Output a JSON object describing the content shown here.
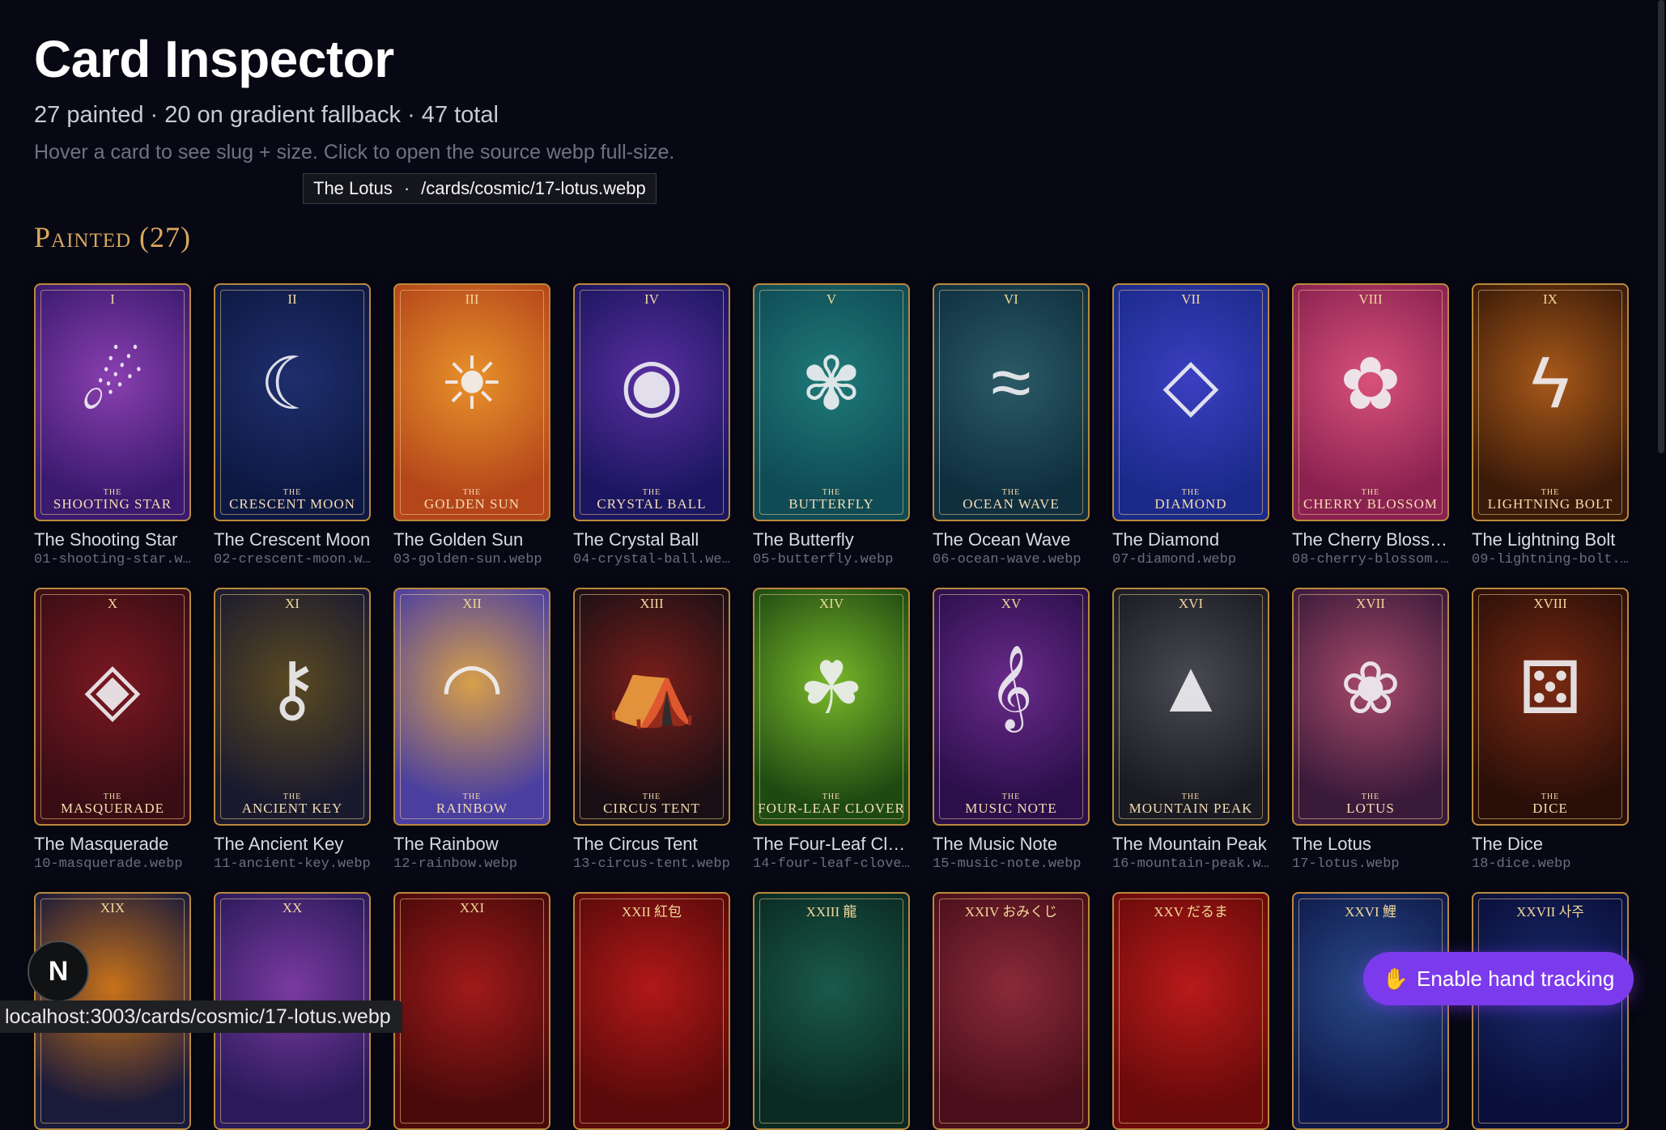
{
  "header": {
    "title": "Card Inspector",
    "stats": "27 painted · 20 on gradient fallback · 47 total",
    "hint": "Hover a card to see slug + size. Click to open the source webp full-size."
  },
  "tooltip": {
    "name": "The Lotus",
    "separator": "·",
    "path": "/cards/cosmic/17-lotus.webp"
  },
  "section": {
    "title": "Painted (27)"
  },
  "cards": [
    {
      "numeral": "I",
      "caption": "Shooting Star",
      "name": "The Shooting Star",
      "slug": "01-shooting-star.webp",
      "colors": [
        "#3a1a6e",
        "#8a3fb0"
      ],
      "glyph": "☄",
      "icon": "comet-icon"
    },
    {
      "numeral": "II",
      "caption": "Crescent Moon",
      "name": "The Crescent Moon",
      "slug": "02-crescent-moon.webp",
      "colors": [
        "#0d1842",
        "#1f2f6e"
      ],
      "glyph": "☾",
      "icon": "moon-icon"
    },
    {
      "numeral": "III",
      "caption": "Golden Sun",
      "name": "The Golden Sun",
      "slug": "03-golden-sun.webp",
      "colors": [
        "#b4461a",
        "#e8922b"
      ],
      "glyph": "☀",
      "icon": "sun-icon"
    },
    {
      "numeral": "IV",
      "caption": "Crystal Ball",
      "name": "The Crystal Ball",
      "slug": "04-crystal-ball.webp",
      "colors": [
        "#1b1660",
        "#5a2fa0"
      ],
      "glyph": "◉",
      "icon": "crystal-ball-icon"
    },
    {
      "numeral": "V",
      "caption": "Butterfly",
      "name": "The Butterfly",
      "slug": "05-butterfly.webp",
      "colors": [
        "#0f4b55",
        "#1f7a78"
      ],
      "glyph": "✾",
      "icon": "butterfly-icon"
    },
    {
      "numeral": "VI",
      "caption": "Ocean Wave",
      "name": "The Ocean Wave",
      "slug": "06-ocean-wave.webp",
      "colors": [
        "#0f2f3f",
        "#2b5a66"
      ],
      "glyph": "≈",
      "icon": "wave-icon"
    },
    {
      "numeral": "VII",
      "caption": "Diamond",
      "name": "The Diamond",
      "slug": "07-diamond.webp",
      "colors": [
        "#1b2a8a",
        "#3b3fc0"
      ],
      "glyph": "◇",
      "icon": "diamond-icon"
    },
    {
      "numeral": "VIII",
      "caption": "Cherry Blossom",
      "name": "The Cherry Blossom",
      "slug": "08-cherry-blossom.webp",
      "colors": [
        "#8a2150",
        "#d8527a"
      ],
      "glyph": "✿",
      "icon": "blossom-icon"
    },
    {
      "numeral": "IX",
      "caption": "Lightning Bolt",
      "name": "The Lightning Bolt",
      "slug": "09-lightning-bolt.webp",
      "colors": [
        "#3a1a08",
        "#a8591a"
      ],
      "glyph": "ϟ",
      "icon": "lightning-icon"
    },
    {
      "numeral": "X",
      "caption": "Masquerade",
      "name": "The Masquerade",
      "slug": "10-masquerade.webp",
      "colors": [
        "#3a0d14",
        "#7a1822"
      ],
      "glyph": "◈",
      "icon": "mask-icon"
    },
    {
      "numeral": "XI",
      "caption": "Ancient Key",
      "name": "The Ancient Key",
      "slug": "11-ancient-key.webp",
      "colors": [
        "#1a1a2e",
        "#5a4a22"
      ],
      "glyph": "⚷",
      "icon": "key-icon"
    },
    {
      "numeral": "XII",
      "caption": "Rainbow",
      "name": "The Rainbow",
      "slug": "12-rainbow.webp",
      "colors": [
        "#4a3fa0",
        "#d8a04a"
      ],
      "glyph": "◠",
      "icon": "rainbow-icon"
    },
    {
      "numeral": "XIII",
      "caption": "Circus Tent",
      "name": "The Circus Tent",
      "slug": "13-circus-tent.webp",
      "colors": [
        "#1a0f14",
        "#7a1e1a"
      ],
      "glyph": "⛺",
      "icon": "tent-icon"
    },
    {
      "numeral": "XIV",
      "caption": "Four-Leaf Clover",
      "name": "The Four-Leaf Clover",
      "slug": "14-four-leaf-clover.webp",
      "colors": [
        "#1e4a12",
        "#7ab82a"
      ],
      "glyph": "☘",
      "icon": "clover-icon"
    },
    {
      "numeral": "XV",
      "caption": "Music Note",
      "name": "The Music Note",
      "slug": "15-music-note.webp",
      "colors": [
        "#2a0f4a",
        "#6a2a8a"
      ],
      "glyph": "𝄞",
      "icon": "music-note-icon"
    },
    {
      "numeral": "XVI",
      "caption": "Mountain Peak",
      "name": "The Mountain Peak",
      "slug": "16-mountain-peak.webp",
      "colors": [
        "#1a1a22",
        "#4a4a52"
      ],
      "glyph": "▲",
      "icon": "mountain-icon"
    },
    {
      "numeral": "XVII",
      "caption": "Lotus",
      "name": "The Lotus",
      "slug": "17-lotus.webp",
      "colors": [
        "#3a1a3a",
        "#a84a6a"
      ],
      "glyph": "❀",
      "icon": "lotus-icon"
    },
    {
      "numeral": "XVIII",
      "caption": "Dice",
      "name": "The Dice",
      "slug": "18-dice.webp",
      "colors": [
        "#2a0f08",
        "#7a2a12"
      ],
      "glyph": "⚄",
      "icon": "dice-icon"
    },
    {
      "numeral": "XIX",
      "caption": "",
      "name": "",
      "slug": "",
      "colors": [
        "#1a1a3a",
        "#c8721a"
      ],
      "glyph": "",
      "icon": "flame-icon"
    },
    {
      "numeral": "XX",
      "caption": "",
      "name": "",
      "slug": "",
      "colors": [
        "#2a1a5a",
        "#7a3aa0"
      ],
      "glyph": "",
      "icon": "galaxy-icon"
    },
    {
      "numeral": "XXI",
      "caption": "",
      "name": "",
      "slug": "",
      "colors": [
        "#4a0a0a",
        "#a01a1a"
      ],
      "glyph": "",
      "icon": "lantern-icon"
    },
    {
      "numeral": "XXII 紅包",
      "caption": "",
      "name": "",
      "slug": "",
      "colors": [
        "#5a0a0a",
        "#b01818"
      ],
      "glyph": "",
      "icon": "envelope-icon"
    },
    {
      "numeral": "XXIII 龍",
      "caption": "",
      "name": "",
      "slug": "",
      "colors": [
        "#0a2a22",
        "#1a5a4a"
      ],
      "glyph": "",
      "icon": "dragon-coin-icon"
    },
    {
      "numeral": "XXIV おみくじ",
      "caption": "",
      "name": "",
      "slug": "",
      "colors": [
        "#4a0f1a",
        "#8a2a3a"
      ],
      "glyph": "",
      "icon": "fortune-slip-icon"
    },
    {
      "numeral": "XXV だるま",
      "caption": "",
      "name": "",
      "slug": "",
      "colors": [
        "#6a0a0a",
        "#b81a1a"
      ],
      "glyph": "",
      "icon": "daruma-icon"
    },
    {
      "numeral": "XXVI 鯉",
      "caption": "",
      "name": "",
      "slug": "",
      "colors": [
        "#0f1a4a",
        "#2a4a8a"
      ],
      "glyph": "",
      "icon": "koi-icon"
    },
    {
      "numeral": "XXVII 사주",
      "caption": "",
      "name": "",
      "slug": "",
      "colors": [
        "#0a0f3a",
        "#1a2a6a"
      ],
      "glyph": "",
      "icon": "constellation-icon"
    }
  ],
  "statusbar": {
    "url": "localhost:3003/cards/cosmic/17-lotus.webp"
  },
  "badge": {
    "letter": "N"
  },
  "hand_tracking": {
    "emoji": "✋",
    "label": "Enable hand tracking"
  }
}
